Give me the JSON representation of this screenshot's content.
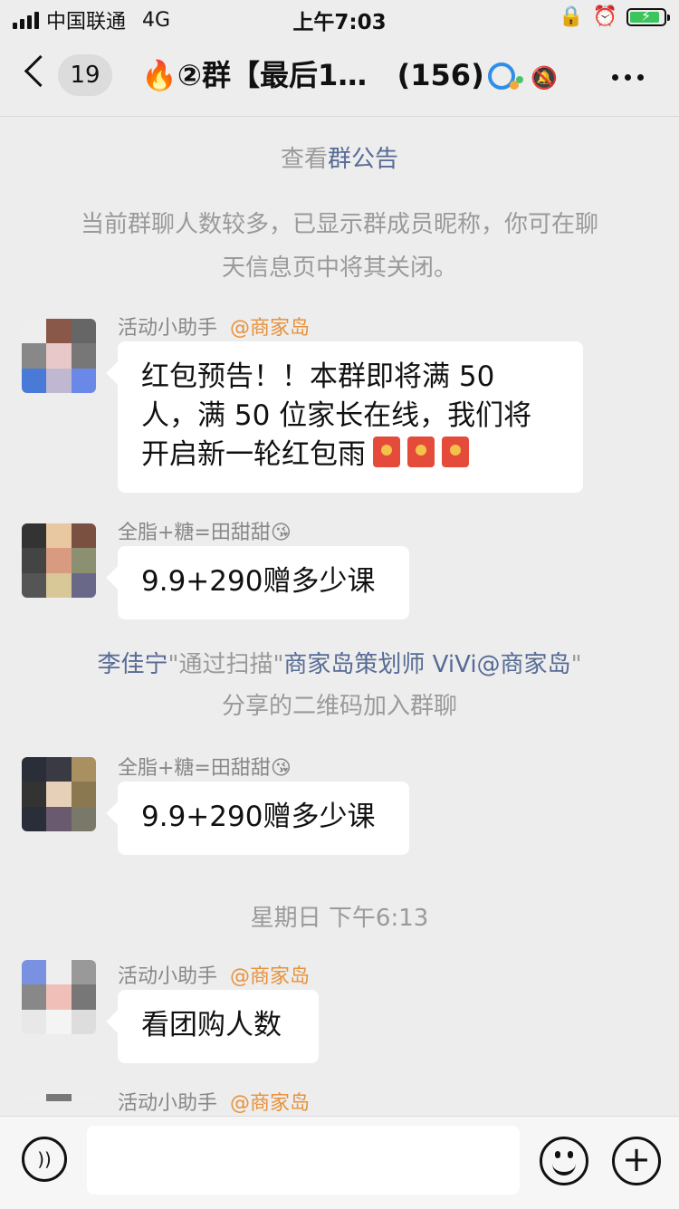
{
  "status_bar": {
    "carrier": "中国联通",
    "network": "4G",
    "time": "上午7:03"
  },
  "nav": {
    "unread_count": "19",
    "title_emoji": "🔥",
    "title": "②群【最后1…",
    "member_count": "(156)"
  },
  "chat": {
    "notice_prefix": "查看",
    "notice_link": "群公告",
    "nickname_notice_1": "当前群聊人数较多，已显示群成员昵称，你可在聊",
    "nickname_notice_2": "天信息页中将其关闭。",
    "messages": [
      {
        "sender": "活动小助手",
        "org": "@商家岛",
        "lines": [
          "红包预告！！本群即将满 50",
          "人，满 50 位家长在线，我们将",
          "开启新一轮红包雨"
        ]
      },
      {
        "sender": "全脂+糖=田甜甜😘",
        "text": "9.9+290赠多少课"
      },
      {
        "sender": "全脂+糖=田甜甜😘",
        "text": "9.9+290赠多少课"
      },
      {
        "sender": "活动小助手",
        "org": "@商家岛",
        "text": "看团购人数"
      },
      {
        "sender": "活动小助手",
        "org": "@商家岛"
      }
    ],
    "join_notice": {
      "name": "李佳宁",
      "q1": "\"通过扫描\"",
      "inviter": "商家岛策划师 ViVi@商家岛",
      "q2": "\"",
      "line2": "分享的二维码加入群聊"
    },
    "timestamp": "星期日 下午6:13"
  },
  "colors": {
    "background": "#ededed",
    "link": "#576b95",
    "org": "#e8913a",
    "red_packet": "#e54b3a"
  }
}
